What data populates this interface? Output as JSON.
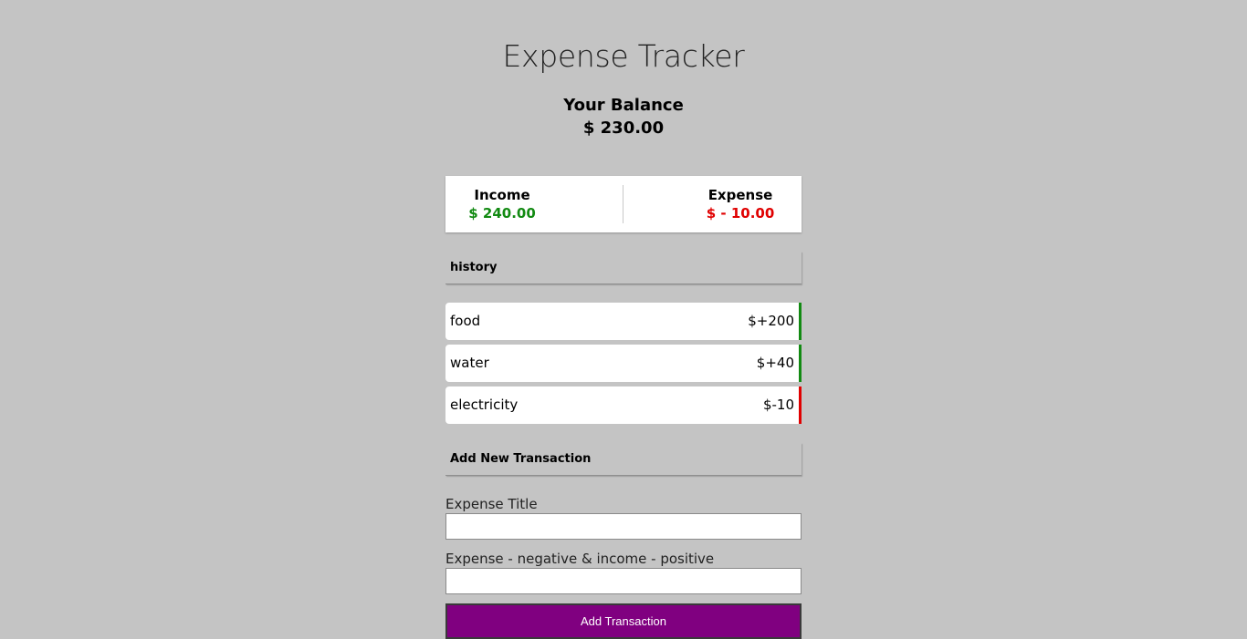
{
  "header": {
    "title": "Expense Tracker",
    "balance_label": "Your Balance",
    "balance_amount": "$ 230.00"
  },
  "summary": {
    "income_label": "Income",
    "income_amount": "$ 240.00",
    "expense_label": "Expense",
    "expense_amount": "$ - 10.00"
  },
  "history": {
    "heading": "history",
    "items": [
      {
        "name": "food",
        "amount": "$+200",
        "type": "income"
      },
      {
        "name": "water",
        "amount": "$+40",
        "type": "income"
      },
      {
        "name": "electricity",
        "amount": "$-10",
        "type": "expense"
      }
    ]
  },
  "form": {
    "heading": "Add New Transaction",
    "title_label": "Expense Title",
    "title_value": "",
    "amount_label": "Expense - negative & income - positive",
    "amount_value": "",
    "submit_label": "Add Transaction"
  },
  "colors": {
    "background": "#c4c4c4",
    "income": "#128a12",
    "expense": "#e00000",
    "button": "#800080"
  }
}
